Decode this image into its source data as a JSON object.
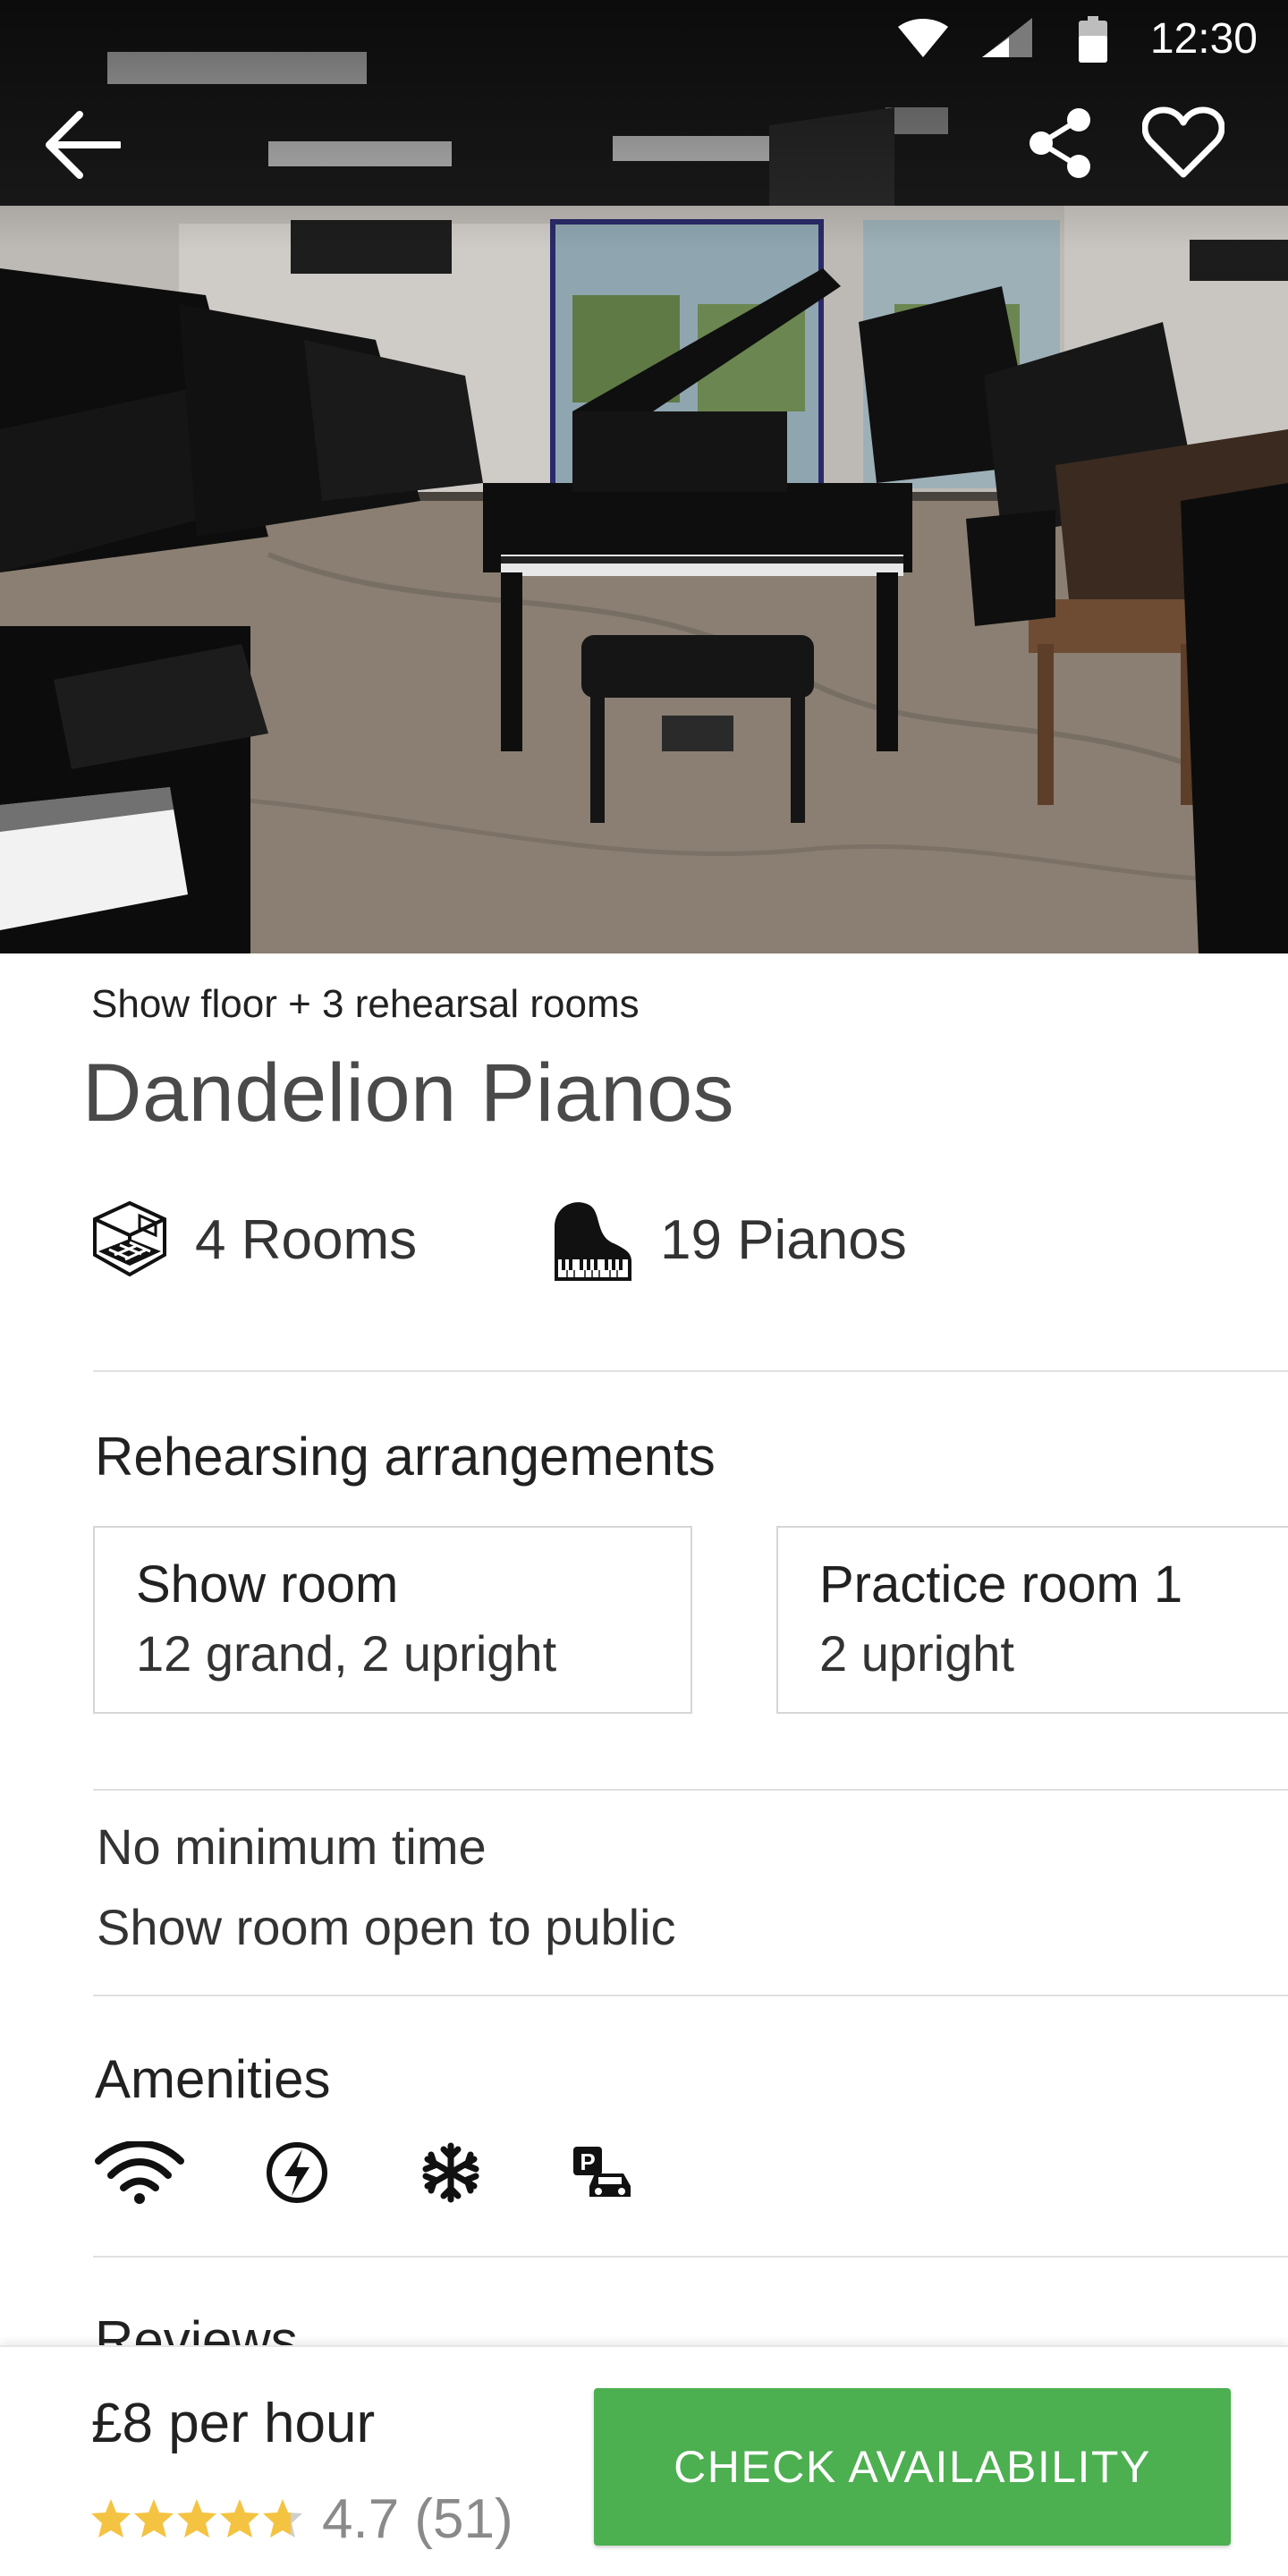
{
  "status_bar": {
    "time": "12:30"
  },
  "hero": {
    "image_description_icon": "piano-showroom-photo"
  },
  "header": {
    "back_icon": "arrow-back-icon",
    "share_icon": "share-icon",
    "favorite_icon": "heart-outline-icon"
  },
  "venue": {
    "subtitle": "Show floor + 3 rehearsal rooms",
    "name": "Dandelion Pianos",
    "rooms_label": "4 Rooms",
    "pianos_label": "19 Pianos"
  },
  "arrangements": {
    "title": "Rehearsing arrangements",
    "rooms": [
      {
        "name": "Show room",
        "pianos": "12 grand, 2 upright"
      },
      {
        "name": "Practice room 1",
        "pianos": "2 upright"
      }
    ]
  },
  "notes": [
    "No minimum time",
    "Show room open to public"
  ],
  "amenities": {
    "title": "Amenities",
    "icons": [
      "wifi-icon",
      "power-icon",
      "air-conditioning-icon",
      "parking-icon"
    ]
  },
  "reviews": {
    "title": "Reviews"
  },
  "booking": {
    "price_amount": "£8",
    "price_unit": "per hour",
    "rating_value": 4.7,
    "rating_text": "4.7 (51)",
    "button_label": "CHECK AVAILABILITY"
  },
  "colors": {
    "accent": "#4caf50",
    "star": "#f5c342",
    "star_empty": "#cfcfcf"
  }
}
